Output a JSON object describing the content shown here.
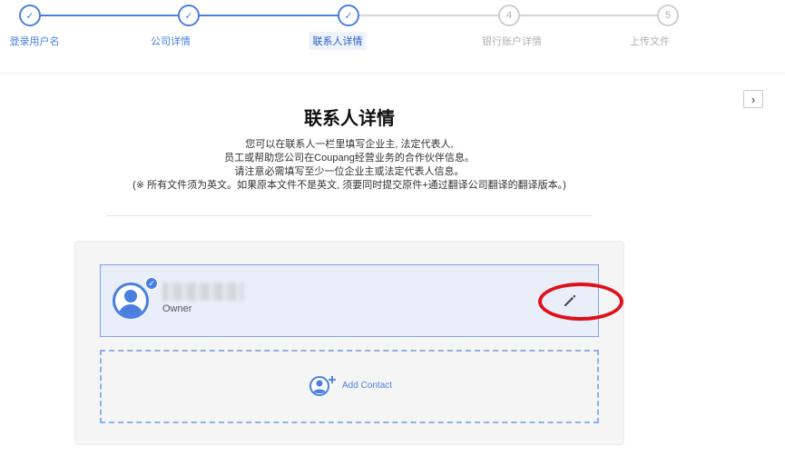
{
  "stepper": {
    "steps": [
      {
        "label": "登录用户名",
        "marker": "✓",
        "state": "done"
      },
      {
        "label": "公司详情",
        "marker": "✓",
        "state": "done"
      },
      {
        "label": "联系人详情",
        "marker": "✓",
        "state": "active"
      },
      {
        "label": "银行账户详情",
        "marker": "4",
        "state": "todo"
      },
      {
        "label": "上传文件",
        "marker": "5",
        "state": "todo"
      }
    ]
  },
  "side_toggle": {
    "icon": "chevron-right-icon",
    "glyph": "›"
  },
  "header": {
    "title": "联系人详情",
    "lines": [
      "您可以在联系人一栏里填写企业主, 法定代表人,",
      "员工或帮助您公司在Coupang经营业务的合作伙伴信息。",
      "请注意必需填写至少一位企业主或法定代表人信息。",
      "(※ 所有文件须为英文。如果原本文件不是英文, 须要同时提交原件+通过翻译公司翻译的翻译版本。)"
    ]
  },
  "contact": {
    "role": "Owner",
    "avatar_icon": "user-avatar-icon",
    "badge_icon": "check-badge-icon",
    "edit_icon": "pencil-icon"
  },
  "add_contact": {
    "label": "Add Contact",
    "icon": "add-user-icon"
  },
  "colors": {
    "accent": "#4a7fe0",
    "card_bg": "#e9eef9",
    "highlight": "#e0101a",
    "todo_gray": "#cfcfcf"
  }
}
